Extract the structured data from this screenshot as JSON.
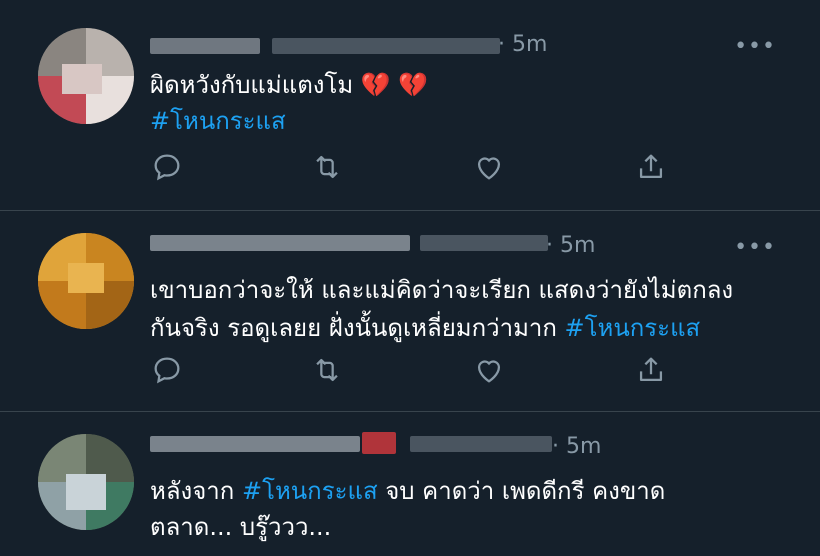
{
  "tweets": [
    {
      "time": "· 5m",
      "lines": [
        [
          "ผิดหวังกับแม่แตงโม 💔 💔"
        ],
        [
          "#โหนกระแส"
        ]
      ],
      "text_line1": "ผิดหวังกับแม่แตงโม 💔 💔",
      "hashtag_line2": "#โหนกระแส"
    },
    {
      "time": "· 5m",
      "text_line1": "เขาบอกว่าจะให้ และแม่คิดว่าจะเรียก แสดงว่ายังไม่ตกลง",
      "text_line2": "กันจริง  รอดูเลยย   ฝั่งนั้นดูเหลี่ยมกว่ามาก  ",
      "hashtag_line2": "#โหนกระแส"
    },
    {
      "time": "· 5m",
      "text_line1_prefix": "หลังจาก ",
      "hashtag_line1": "#โหนกระแส",
      "text_line1_suffix": " จบ คาดว่า เพดดีกรี คงขาด",
      "text_line2": "ตลาด... บรู๊ววว..."
    }
  ],
  "more_label": "•••",
  "colors": {
    "background": "#15202b",
    "hashtag": "#1da1f2",
    "muted": "#8899a6",
    "divider": "#38444d"
  },
  "icons": [
    "reply-icon",
    "retweet-icon",
    "like-icon",
    "share-icon",
    "more-icon"
  ]
}
